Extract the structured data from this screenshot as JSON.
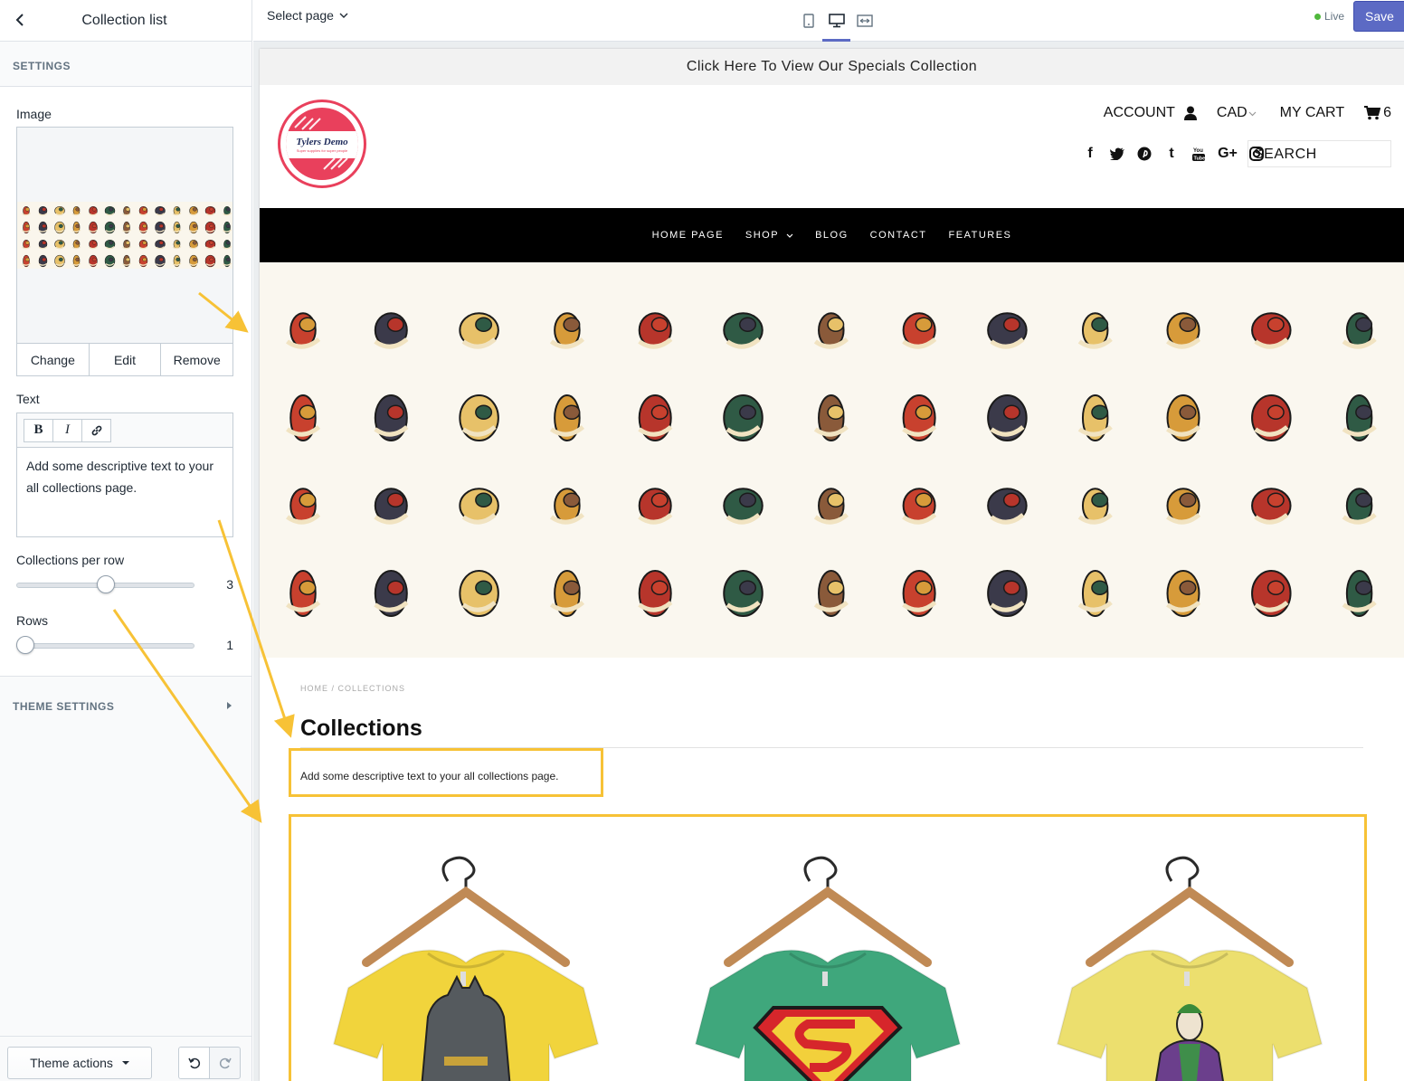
{
  "editor": {
    "panel_title": "Collection list",
    "settings_heading": "SETTINGS",
    "image": {
      "label": "Image",
      "buttons": [
        "Change",
        "Edit",
        "Remove"
      ]
    },
    "text": {
      "label": "Text",
      "toolbar": {
        "bold": "B",
        "italic": "I"
      },
      "value": "Add some descriptive text to your all collections page."
    },
    "collections_per_row": {
      "label": "Collections per row",
      "value": "3",
      "fraction": 0.5
    },
    "rows": {
      "label": "Rows",
      "value": "1",
      "fraction": 0
    },
    "theme_settings": "THEME SETTINGS",
    "theme_actions": "Theme actions"
  },
  "toolbar": {
    "select_page": "Select page",
    "status": "Live",
    "save_label": "Save"
  },
  "store": {
    "announcement": "Click Here To View Our Specials Collection",
    "logo": {
      "name": "Tylers Demo",
      "tagline": "Super supplies for super people"
    },
    "account": "ACCOUNT",
    "currency": "CAD",
    "cart_label": "MY CART",
    "cart_count": "6",
    "search_placeholder": "SEARCH",
    "nav": [
      "HOME PAGE",
      "SHOP",
      "BLOG",
      "CONTACT",
      "FEATURES"
    ],
    "breadcrumb": {
      "home": "HOME",
      "sep": "/",
      "current": "COLLECTIONS"
    },
    "page_title": "Collections",
    "description": "Add some descriptive text to your all collections page.",
    "collections": [
      {
        "shirt_color": "#f1d43c",
        "print": "batman"
      },
      {
        "shirt_color": "#3fa77c",
        "print": "superman"
      },
      {
        "shirt_color": "#ecdf6e",
        "print": "joker"
      }
    ]
  },
  "colors": {
    "accent": "#5c6ac4",
    "highlight": "#f7c236",
    "live": "#50b83c",
    "logo": "#e9405c"
  }
}
